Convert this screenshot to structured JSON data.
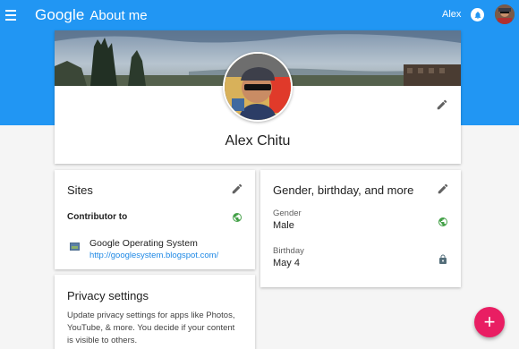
{
  "header": {
    "logo": "Google",
    "product": "About me",
    "user_name": "Alex",
    "icons": {
      "menu": "menu-icon",
      "notifications": "notifications-icon",
      "account": "account-avatar"
    },
    "bg_color": "#2196f3"
  },
  "profile": {
    "name": "Alex Chitu"
  },
  "sites_card": {
    "title": "Sites",
    "section_label": "Contributor to",
    "site": {
      "name": "Google Operating System",
      "url": "http://googlesystem.blogspot.com/"
    }
  },
  "privacy_card": {
    "title": "Privacy settings",
    "description": "Update privacy settings for apps like Photos, YouTube, & more. You decide if your content is visible to others."
  },
  "basics_card": {
    "title": "Gender, birthday, and more",
    "gender": {
      "label": "Gender",
      "value": "Male"
    },
    "birthday": {
      "label": "Birthday",
      "value": "May 4"
    }
  },
  "fab": {
    "label": "+",
    "color": "#e91e63"
  },
  "colors": {
    "globe": "#43a047",
    "link": "#1e88e5",
    "lock": "#546e7a"
  }
}
